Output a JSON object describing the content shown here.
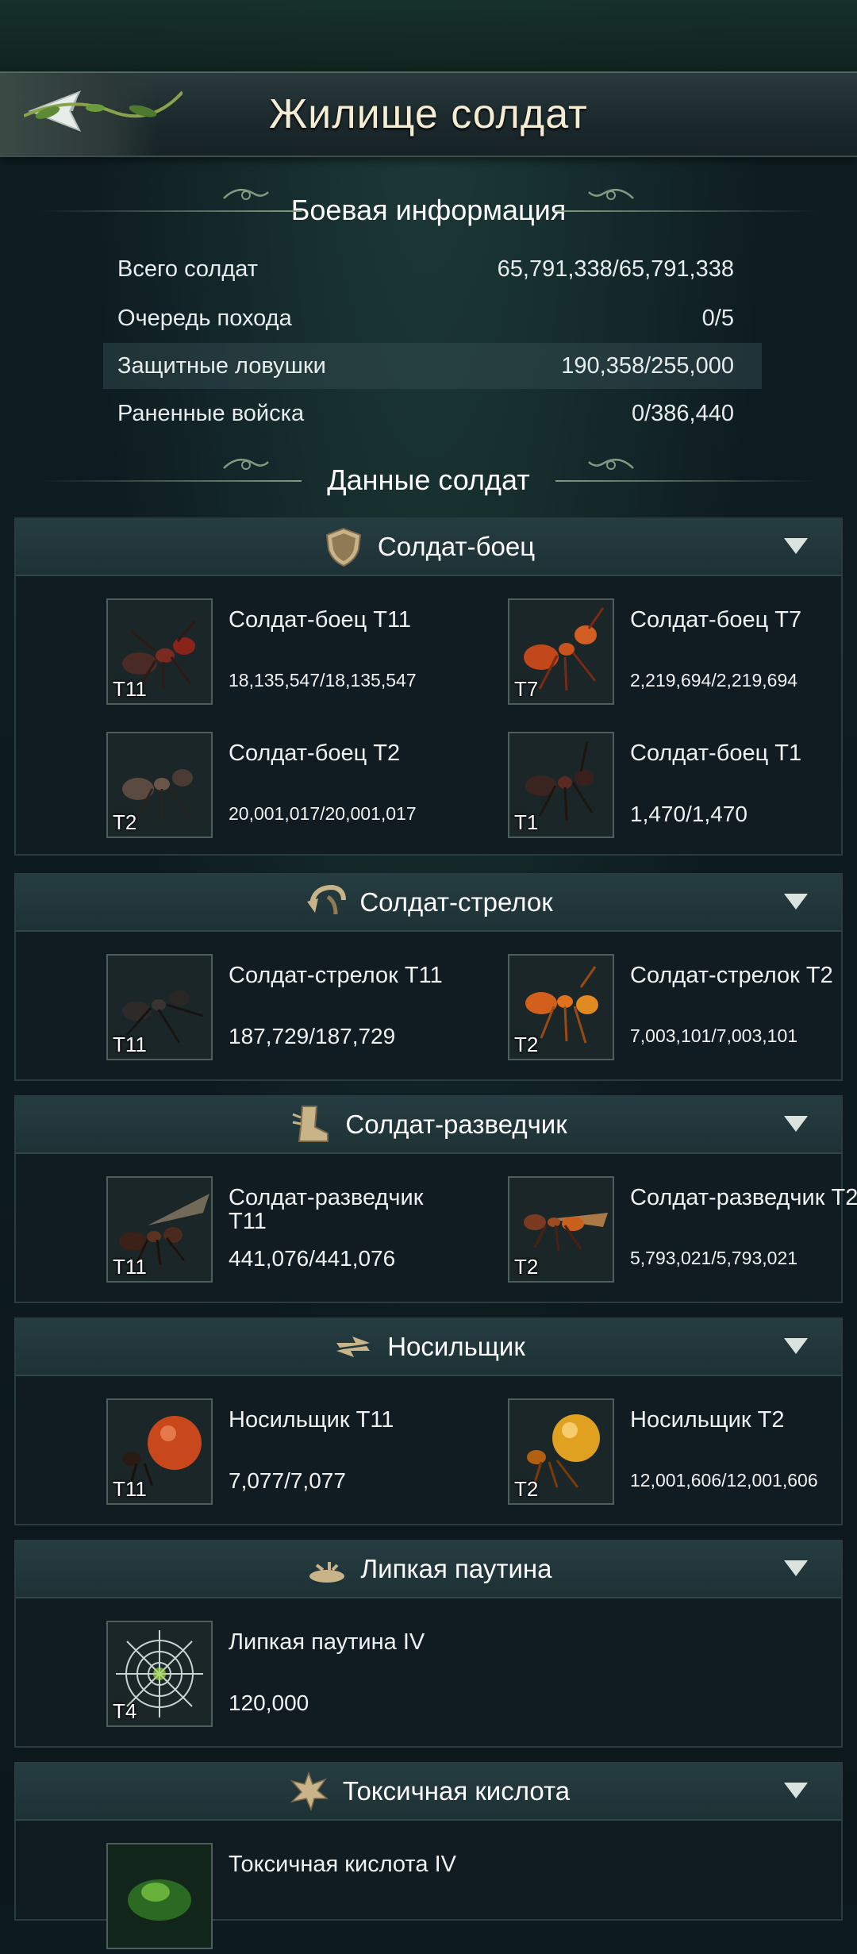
{
  "header": {
    "title": "Жилище солдат"
  },
  "battle_info": {
    "title": "Боевая информация",
    "rows": [
      {
        "label": "Всего солдат",
        "value": "65,791,338/65,791,338"
      },
      {
        "label": "Очередь похода",
        "value": "0/5"
      },
      {
        "label": "Защитные ловушки",
        "value": "190,358/255,000"
      },
      {
        "label": "Раненные войска",
        "value": "0/386,440"
      }
    ]
  },
  "soldier_data": {
    "title": "Данные солдат"
  },
  "panels": [
    {
      "title": "Солдат-боец",
      "icon": "shield-icon",
      "units": [
        {
          "name": "Солдат-боец Т11",
          "count": "18,135,547/18,135,547",
          "tier": "T11"
        },
        {
          "name": "Солдат-боец Т7",
          "count": "2,219,694/2,219,694",
          "tier": "T7"
        },
        {
          "name": "Солдат-боец Т2",
          "count": "20,001,017/20,001,017",
          "tier": "T2"
        },
        {
          "name": "Солдат-боец Т1",
          "count": "1,470/1,470",
          "tier": "T1"
        }
      ]
    },
    {
      "title": "Солдат-стрелок",
      "icon": "bow-icon",
      "units": [
        {
          "name": "Солдат-стрелок Т11",
          "count": "187,729/187,729",
          "tier": "T11"
        },
        {
          "name": "Солдат-стрелок Т2",
          "count": "7,003,101/7,003,101",
          "tier": "T2"
        }
      ]
    },
    {
      "title": "Солдат-разведчик",
      "icon": "boot-icon",
      "units": [
        {
          "name": "Солдат-разведчик Т11",
          "count": "441,076/441,076",
          "tier": "T11"
        },
        {
          "name": "Солдат-разведчик Т2",
          "count": "5,793,021/5,793,021",
          "tier": "T2"
        }
      ]
    },
    {
      "title": "Носильщик",
      "icon": "carrier-icon",
      "units": [
        {
          "name": "Носильщик Т11",
          "count": "7,077/7,077",
          "tier": "T11"
        },
        {
          "name": "Носильщик Т2",
          "count": "12,001,606/12,001,606",
          "tier": "T2"
        }
      ]
    },
    {
      "title": "Липкая паутина",
      "icon": "web-trap-icon",
      "units": [
        {
          "name": "Липкая паутина IV",
          "count": "120,000",
          "tier": "T4"
        }
      ]
    },
    {
      "title": "Токсичная кислота",
      "icon": "acid-icon",
      "units": [
        {
          "name": "Токсичная кислота IV",
          "count": "",
          "tier": ""
        }
      ]
    }
  ]
}
